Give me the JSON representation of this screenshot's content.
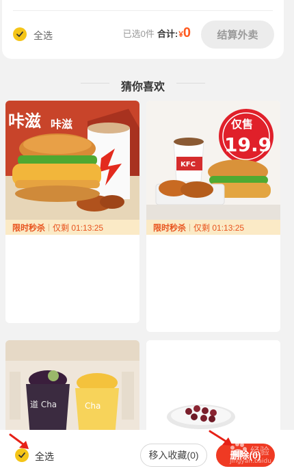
{
  "cart_summary": {
    "select_all_label": "全选",
    "selected_text": "已选0件",
    "total_label": "合计:",
    "currency": "¥",
    "total_amount": "0",
    "checkout_label": "结算外卖"
  },
  "recommend": {
    "title": "猜你喜欢",
    "cards": [
      {
        "image_texts": [
          "咔滋",
          "咔滋"
        ],
        "flash_tag": "限时秒杀",
        "countdown": "仅剩 01:13:25"
      },
      {
        "image_texts": [
          "KFC",
          "仅售",
          "19.9"
        ],
        "flash_tag": "限时秒杀",
        "countdown": "仅剩 01:13:25"
      },
      {
        "image_texts": [
          "道 Cha",
          "Cha"
        ]
      },
      {
        "image_texts": []
      }
    ]
  },
  "bottom_bar": {
    "select_all_label": "全选",
    "move_to_favorites_label": "移入收藏(0)",
    "delete_label": "删除(0)"
  },
  "watermark": "Bai 经验 jingyan.baidu.com",
  "colors": {
    "accent_yellow": "#f5c518",
    "price_orange": "#ff5a1f",
    "delete_red": "#ef3a23",
    "flash_bg": "#fbeac6",
    "annotation_red": "#e62117"
  }
}
